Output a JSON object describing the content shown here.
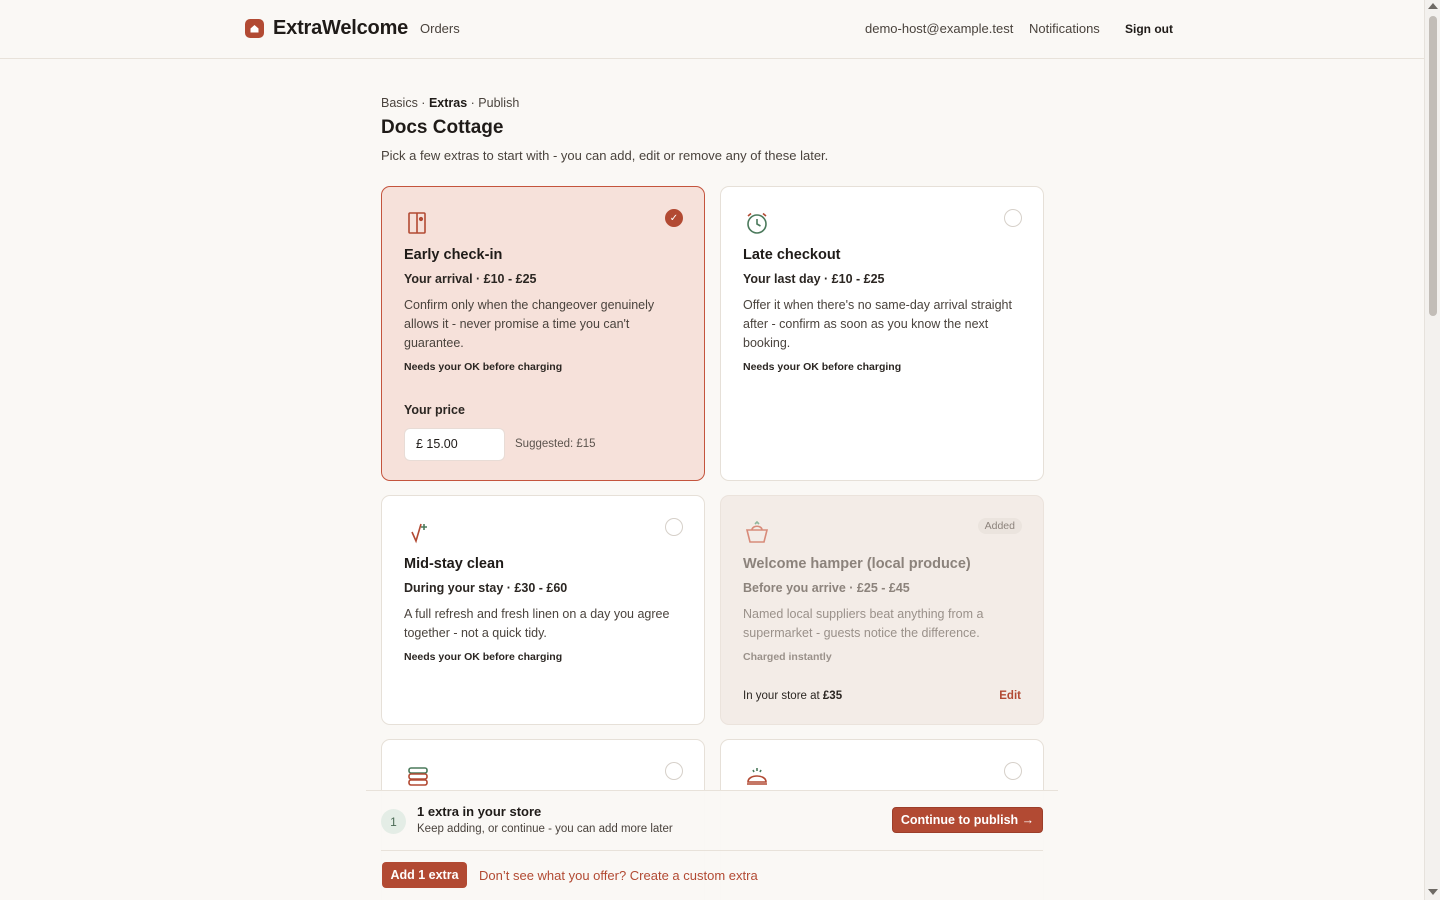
{
  "header": {
    "brand": "ExtraWelcome",
    "nav_orders": "Orders",
    "email": "demo-host@example.test",
    "notifications": "Notifications",
    "sign_out": "Sign out"
  },
  "breadcrumb": {
    "step1": "Basics",
    "sep": " · ",
    "step2": "Extras",
    "step3": "Publish"
  },
  "page": {
    "title": "Docs Cottage",
    "subtitle": "Pick a few extras to start with - you can add, edit or remove any of these later."
  },
  "cards": [
    {
      "title": "Early check-in",
      "meta": "Your arrival · £10 - £25",
      "desc": "Confirm only when the changeover genuinely allows it - never promise a time you can't guarantee.",
      "note": "Needs your OK before charging",
      "price_label": "Your price",
      "price_value": "£ 15.00",
      "suggested": "Suggested: £15",
      "check": "✓",
      "icon": "door-icon"
    },
    {
      "title": "Late checkout",
      "meta": "Your last day · £10 - £25",
      "desc": "Offer it when there's no same-day arrival straight after - confirm as soon as you know the next booking.",
      "note": "Needs your OK before charging",
      "icon": "alarm-clock-icon"
    },
    {
      "title": "Mid-stay clean",
      "meta": "During your stay · £30 - £60",
      "desc": "A full refresh and fresh linen on a day you agree together - not a quick tidy.",
      "note": "Needs your OK before charging",
      "icon": "broom-sparkle-icon"
    },
    {
      "title": "Welcome hamper (local produce)",
      "meta": "Before you arrive · £25 - £45",
      "desc": "Named local suppliers beat anything from a supermarket - guests notice the difference.",
      "note": "Charged instantly",
      "badge": "Added",
      "store_prefix": "In your store at ",
      "store_price": "£35",
      "edit": "Edit",
      "icon": "basket-icon"
    }
  ],
  "bottom_cards": [
    {
      "icon": "towels-icon"
    },
    {
      "icon": "cloche-icon"
    }
  ],
  "footer": {
    "count": "1",
    "title": "1 extra in your store",
    "subtitle": "Keep adding, or continue - you can add more later",
    "publish_button": "Continue to publish →",
    "add_button": "Add 1 extra",
    "custom_link": "Don’t see what you offer? Create a custom extra"
  },
  "colors": {
    "accent": "#b24a33",
    "selected_bg": "#f6e1da",
    "added_bg": "#f3ece7",
    "page_bg": "#faf8f5"
  }
}
